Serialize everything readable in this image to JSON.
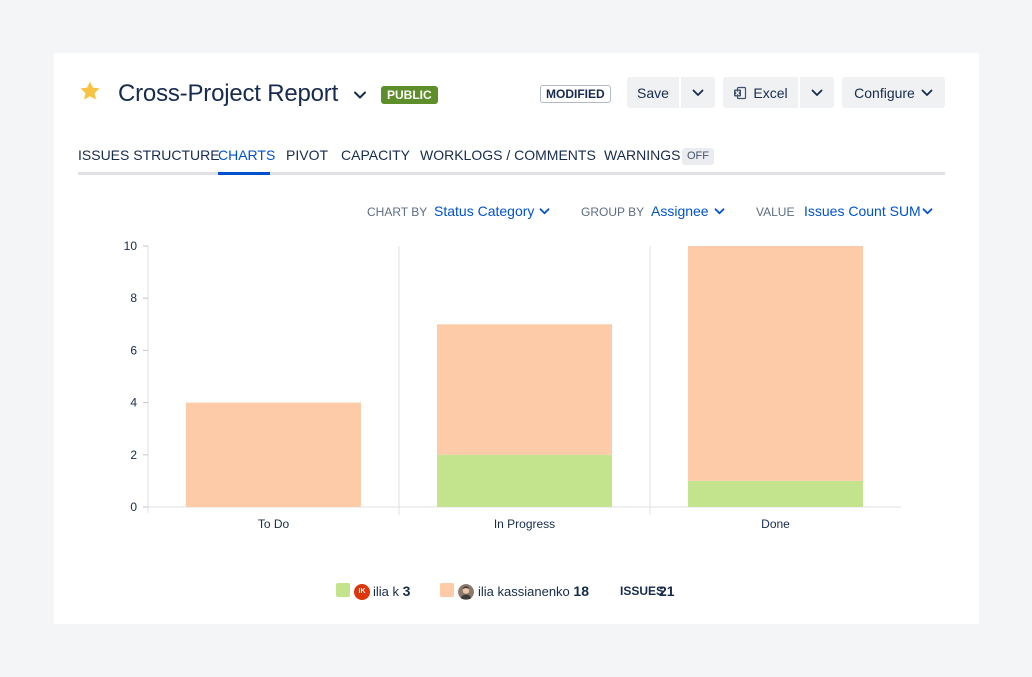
{
  "header": {
    "title": "Cross-Project Report",
    "visibility_badge": "PUBLIC",
    "modified_badge": "MODIFIED",
    "save_label": "Save",
    "excel_label": "Excel",
    "configure_label": "Configure",
    "star_color": "#f6c342",
    "public_color": "#5e8e2a"
  },
  "tabs": [
    {
      "label": "ISSUES STRUCTURE",
      "active": false
    },
    {
      "label": "CHARTS",
      "active": true
    },
    {
      "label": "PIVOT",
      "active": false
    },
    {
      "label": "CAPACITY",
      "active": false
    },
    {
      "label": "WORKLOGS / COMMENTS",
      "active": false
    },
    {
      "label": "WARNINGS",
      "active": false,
      "badge": "OFF"
    }
  ],
  "controls": {
    "chart_by_label": "CHART BY",
    "chart_by_value": "Status Category",
    "group_by_label": "GROUP BY",
    "group_by_value": "Assignee",
    "value_label": "VALUE",
    "value_value": "Issues Count SUM"
  },
  "chart_data": {
    "type": "bar",
    "stacked": true,
    "categories": [
      "To Do",
      "In Progress",
      "Done"
    ],
    "series": [
      {
        "name": "ilia k",
        "color": "#c3e48d",
        "values": [
          0,
          2,
          1
        ]
      },
      {
        "name": "ilia kassianenko",
        "color": "#fdcba8",
        "values": [
          4,
          5,
          9
        ]
      }
    ],
    "yticks": [
      "0",
      "2",
      "4",
      "6",
      "8",
      "10"
    ],
    "ylim": [
      0,
      10
    ],
    "title": "",
    "xlabel": "",
    "ylabel": ""
  },
  "legend": {
    "items": [
      {
        "name": "ilia k",
        "count": "3",
        "avatar_initials": "IK",
        "avatar_color": "#de350b"
      },
      {
        "name": "ilia kassianenko",
        "count": "18"
      }
    ],
    "issues_label": "ISSUES",
    "issues_count": "21"
  }
}
